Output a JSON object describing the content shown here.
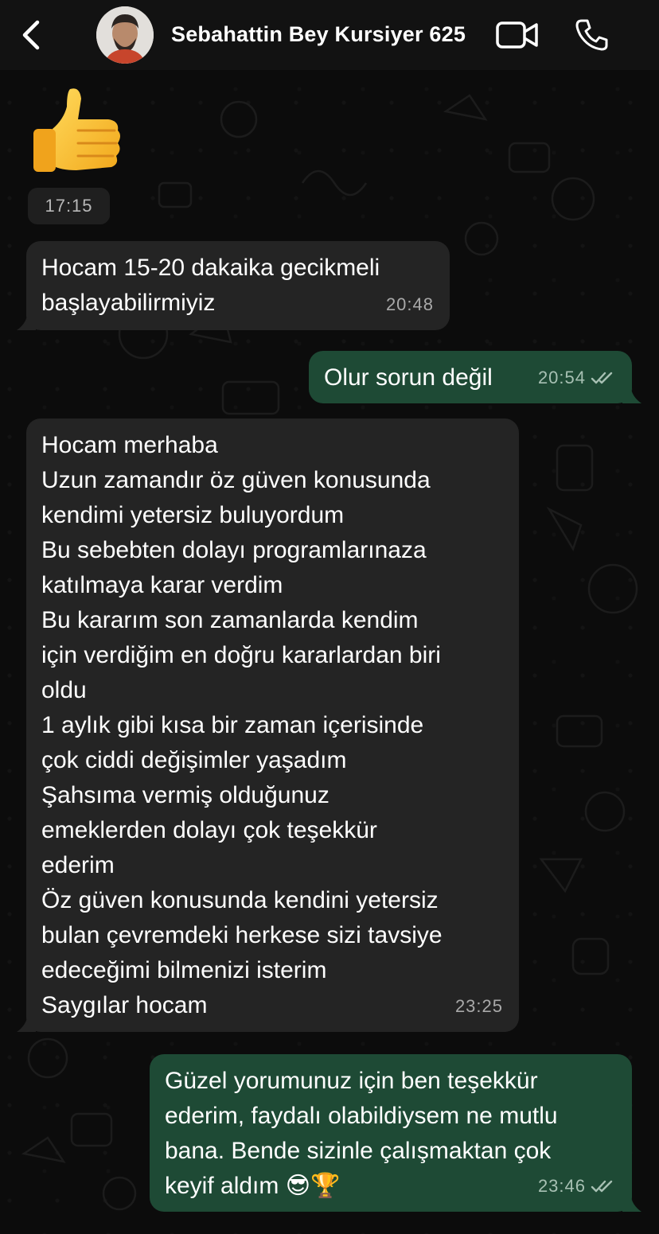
{
  "header": {
    "back_icon": "chevron-left-icon",
    "contact_name": "Sebahattin Bey Kursiyer 625",
    "video_icon": "video-camera-icon",
    "call_icon": "phone-icon"
  },
  "messages": [
    {
      "direction": "incoming",
      "type": "sticker",
      "sticker": "thumbs-up-emoji",
      "time": "17:15"
    },
    {
      "direction": "incoming",
      "text": "Hocam 15-20 dakaika gecikmeli\nbaşlayabilirmiyiz",
      "time": "20:48"
    },
    {
      "direction": "outgoing",
      "text": "Olur sorun değil",
      "time": "20:54",
      "status": "read-double-check"
    },
    {
      "direction": "incoming",
      "text": "Hocam merhaba\nUzun zamandır öz güven konusunda\nkendimi yetersiz buluyordum\nBu sebebten dolayı programlarınaza\nkatılmaya karar verdim\nBu kararım son zamanlarda kendim\niçin verdiğim en doğru kararlardan biri\noldu\n1 aylık gibi kısa bir zaman içerisinde\nçok ciddi değişimler yaşadım\nŞahsıma vermiş olduğunuz\nemeklerden dolayı çok teşekkür\nederim\nÖz güven konusunda kendini yetersiz\nbulan çevremdeki herkese sizi tavsiye\nedeceğimi bilmenizi isterim\nSaygılar hocam",
      "time": "23:25"
    },
    {
      "direction": "outgoing",
      "text": "Güzel yorumunuz için ben teşekkür\nederim, faydalı olabildiysem ne mutlu\nbana. Bende sizinle çalışmaktan çok\nkeyif aldım 😎🏆",
      "time": "23:46",
      "status": "read-double-check"
    }
  ],
  "colors": {
    "background": "#0c0c0c",
    "header": "#121212",
    "incoming_bubble": "#242424",
    "outgoing_bubble": "#1e4a35"
  }
}
